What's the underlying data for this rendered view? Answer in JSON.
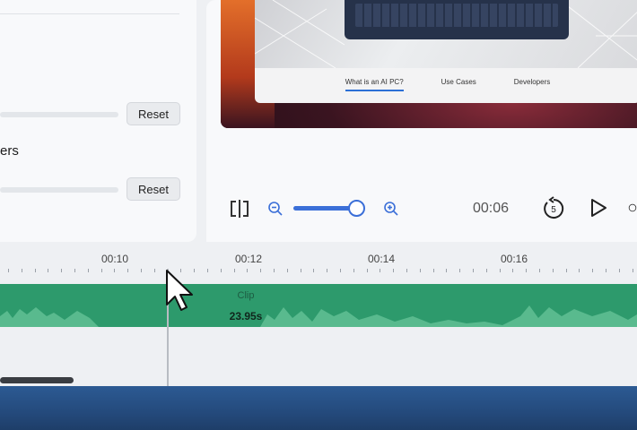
{
  "left_panel": {
    "partial_label": "ers",
    "reset_buttons": [
      {
        "label": "Reset"
      },
      {
        "label": "Reset"
      }
    ]
  },
  "preview": {
    "website_tabs": [
      {
        "label": "What is an AI PC?",
        "active": true
      },
      {
        "label": "Use Cases",
        "active": false
      },
      {
        "label": "Developers",
        "active": false
      }
    ],
    "controls": {
      "current_time": "00:06",
      "zoom_level_fraction": 0.82,
      "rewind_seconds": "5"
    }
  },
  "timeline": {
    "ruler_labels": [
      "00:10",
      "00:12",
      "00:14",
      "00:16"
    ],
    "clip": {
      "label": "Clip",
      "duration": "23.95s"
    }
  },
  "colors": {
    "accent": "#3b6fd8",
    "clip_green": "#2d9a6c",
    "bottom_band": "#2c5a93"
  }
}
